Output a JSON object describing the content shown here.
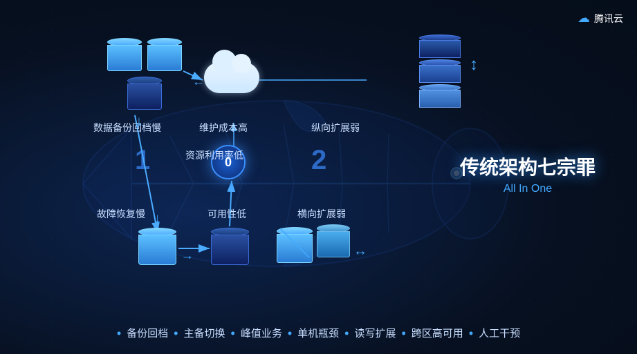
{
  "logo": {
    "icon": "☁",
    "text": "腾讯云"
  },
  "title": {
    "cn": "传统架构七宗罪",
    "en": "All In One"
  },
  "center": {
    "label": "0"
  },
  "numbers": {
    "one": "1",
    "two": "2"
  },
  "labels": {
    "data_backup": "数据备份回档慢",
    "maintenance_cost": "维护成本高",
    "vertical_scale": "纵向扩展弱",
    "resource_util": "资源利用率低",
    "recovery_slow": "故障恢复慢",
    "availability": "可用性低",
    "horizontal_scale": "横向扩展弱"
  },
  "bullets": [
    "备份回档",
    "主备切换",
    "峰值业务",
    "单机瓶颈",
    "读写扩展",
    "跨区高可用",
    "人工干预"
  ],
  "colors": {
    "accent": "#4aabff",
    "bg": "#0a1628",
    "text": "#c8deff",
    "highlight": "#3a8fff"
  }
}
